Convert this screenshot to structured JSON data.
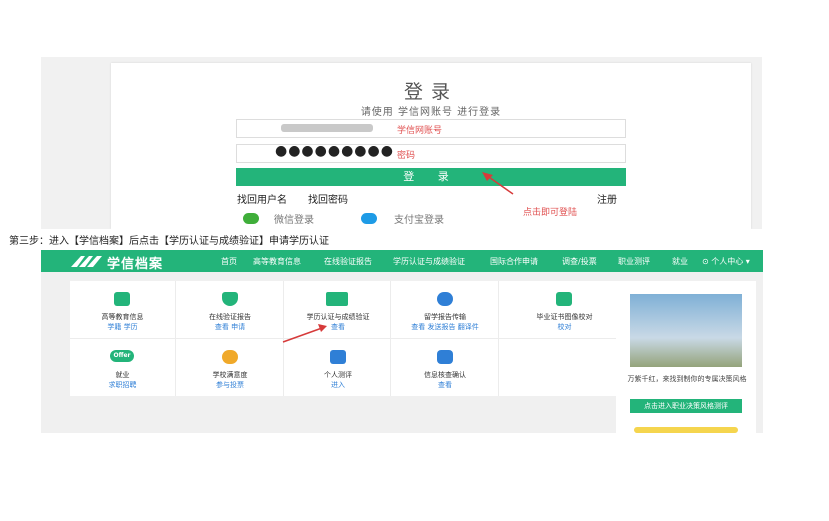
{
  "login": {
    "title": "登录",
    "subtitle": "请使用 学信网账号 进行登录",
    "username_hint": "学信网账号",
    "password_mask": "●●●●●●●●●",
    "password_hint": "密码",
    "login_button": "登 录",
    "find_username": "找回用户名",
    "find_password": "找回密码",
    "register": "注册",
    "wechat_login": "微信登录",
    "alipay_login": "支付宝登录",
    "annotation": "点击即可登陆"
  },
  "caption": "第三步：进入【学信档案】后点击【学历认证与成绩验证】申请学历认证",
  "xuexin": {
    "logo": "学信档案",
    "nav": [
      "首页",
      "高等教育信息",
      "在线验证报告",
      "学历认证与成绩验证",
      "国际合作申请",
      "调查/投票",
      "职业测评",
      "就业"
    ],
    "user_center": "⊙ 个人中心 ▾",
    "cells": [
      {
        "title": "高等教育信息",
        "links": "学籍  学历",
        "icon_color": "#23b47a",
        "icon": "graduation-cap-icon"
      },
      {
        "title": "在线验证报告",
        "links": "查看  申请",
        "icon_color": "#23b47a",
        "icon": "shield-check-icon"
      },
      {
        "title": "学历认证与成绩验证",
        "links": "查看",
        "icon_color": "#23b47a",
        "icon": "certificate-icon"
      },
      {
        "title": "留学报告传输",
        "links": "查看  发送报告  翻译件",
        "icon_color": "#2f7fd6",
        "icon": "globe-icon"
      },
      {
        "title": "毕业证书图像校对",
        "links": "校对",
        "icon_color": "#23b47a",
        "icon": "user-card-icon"
      },
      {
        "title": "就业",
        "links": "求职招聘",
        "icon_color": "#23b47a",
        "icon": "offer-icon"
      },
      {
        "title": "学校满意度",
        "links": "参与投票",
        "icon_color": "#f0a92a",
        "icon": "smile-icon"
      },
      {
        "title": "个人测评",
        "links": "进入",
        "icon_color": "#2f7fd6",
        "icon": "checkmark-icon"
      },
      {
        "title": "信息核查确认",
        "links": "查看",
        "icon_color": "#2f7fd6",
        "icon": "person-icon"
      }
    ],
    "offer_label": "Offer",
    "side_text": "万紫千红，来找到制你的专属决策风格",
    "side_button": "点击进入职业决策风格测评"
  },
  "colors": {
    "brand_green": "#23b47a",
    "link_blue": "#2f7fd6",
    "annotation_red": "#e05050"
  }
}
